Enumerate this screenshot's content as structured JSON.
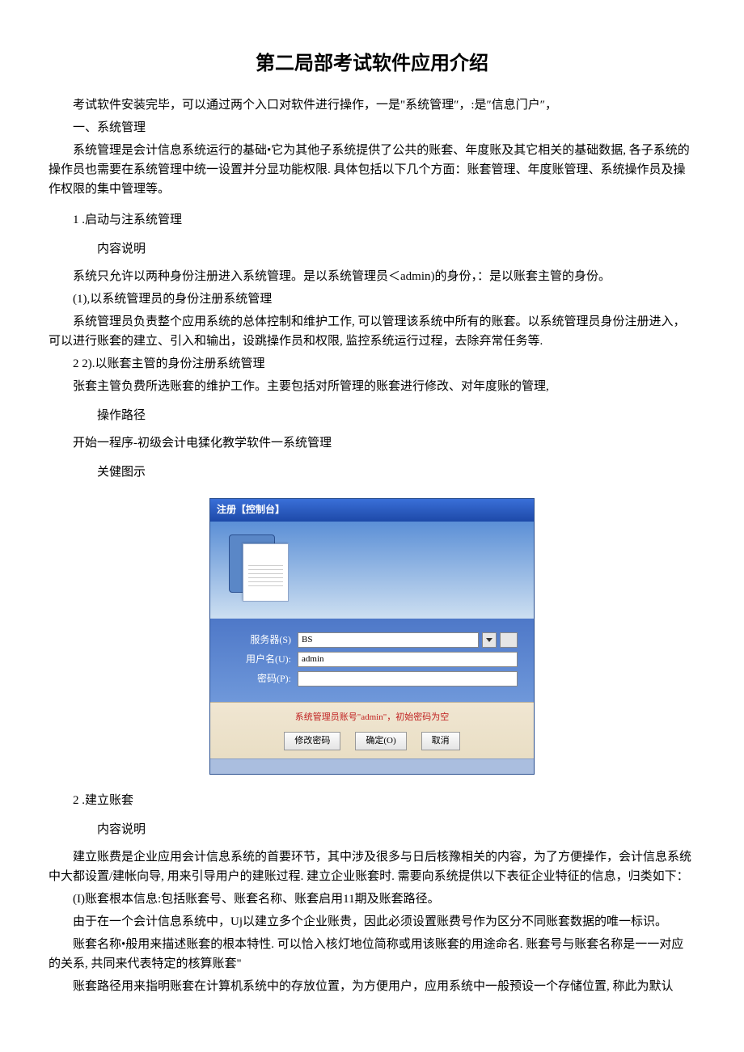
{
  "title": "第二局部考试软件应用介绍",
  "p1": "考试软件安装完毕，可以通过两个入口对软件进行操作，一是\"系统管理″，:是″信息门户″，",
  "p2": "一、系统管理",
  "p3": "系统管理是会计信息系统运行的基础•它为其他子系统提供了公共的账套、年度账及其它相关的基础数据, 各子系统的操作员也需要在系统管理中统一设置并分显功能权限. 具体包括以下几个方面：账套管理、年度账管理、系统操作员及操作权限的集中管理等。",
  "sec1_num": "1 .启动与注系统管理",
  "sub1_1": "内容说明",
  "p4": "系统只允许以两种身份注册进入系统管理。是以系统管理员＜admin)的身份，：是以账套主管的身份。",
  "p5": "(1),以系统管理员的身份注册系统管理",
  "p6": "系统管理员负责整个应用系统的总体控制和维护工作, 可以管理该系统中所有的账套。以系统管理员身份注册进入，可以进行账套的建立、引入和输出，设跳操作员和权限, 监控系统运行过程，去除弃常任务等.",
  "p7": "2  2).以账套主管的身份注册系统管理",
  "p8": "张套主管负费所选账套的维护工作。主要包括对所管理的账套进行修改、对年度账的管理,",
  "sub1_2": "操作路径",
  "p9": "开始一程序-初级会计电猱化教学软件一系统管理",
  "sub1_3": "关健图示",
  "dialog": {
    "title": "注册【控制台】",
    "server_label": "服务器(S)",
    "server_value": "BS",
    "user_label": "用户名(U):",
    "user_value": "admin",
    "pwd_label": "密码(P):",
    "pwd_value": "",
    "hint": "系统管理员账号\"admin\"，初始密码为空",
    "btn_change": "修改密码",
    "btn_ok": "确定(O)",
    "btn_cancel": "取消"
  },
  "sec2_num": "2  .建立账套",
  "sub2_1": "内容说明",
  "p10": "建立账费是企业应用会计信息系统的首要环节，其中涉及很多与日后核豫相关的内容，为了方便操作，会计信息系统中大都设置/建帐向导, 用来引导用户的建账过程. 建立企业账套时. 需要向系统提供以下表征企业特征的信息，归类如下：",
  "p11": "(I)账套根本信息:包括账套号、账套名称、账套启用11期及账套路径。",
  "p12": "由于在一个会计信息系统中，Uj以建立多个企业账贵，因此必须设置账费号作为区分不同账套数据的唯一标识。",
  "p13": "账套名称•般用来描述账套的根本特性. 可以恰入核灯地位简称或用该账套的用途命名. 账套号与账套名称是一一对应的关系, 共同来代表特定的核算账套\"",
  "p14": "账套路径用来指明账套在计算机系统中的存放位置，为方便用户，应用系统中一般预设一个存储位置, 称此为默认"
}
